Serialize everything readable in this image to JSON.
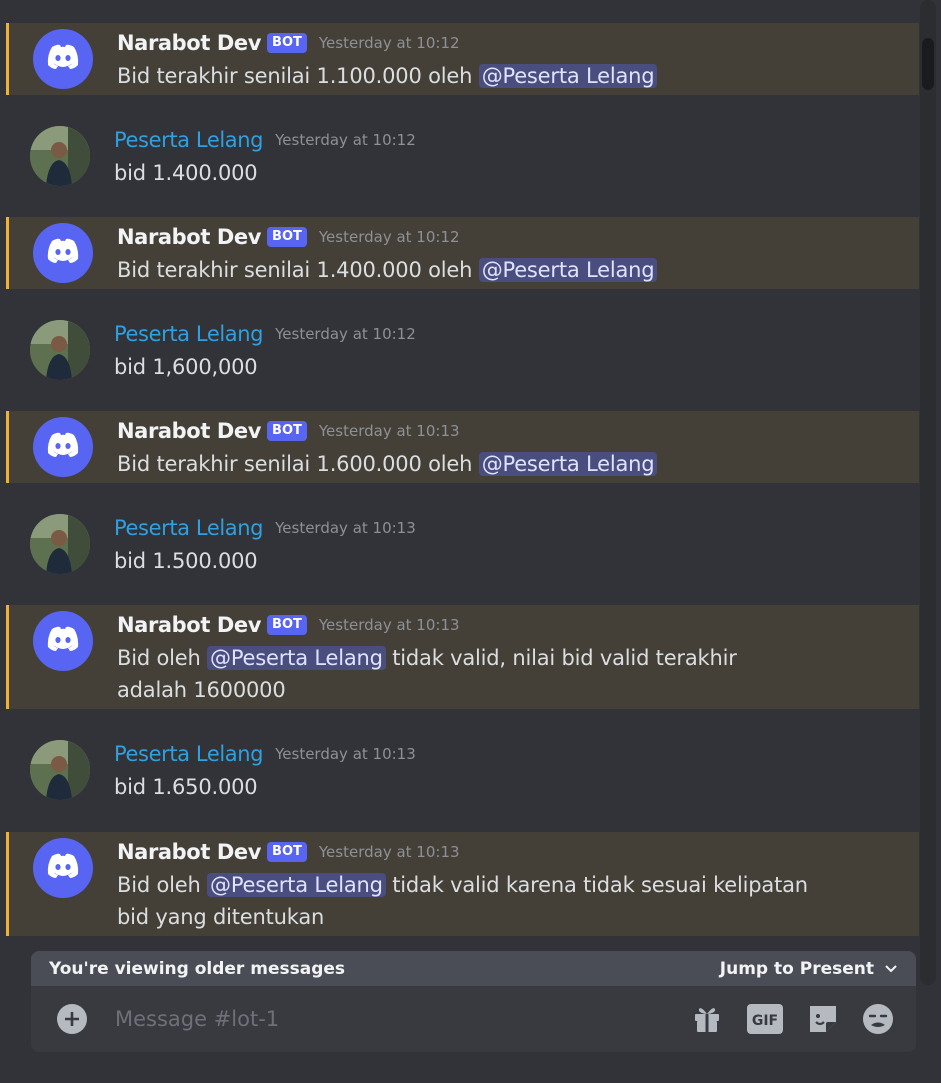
{
  "messages": [
    {
      "author": "Narabot Dev",
      "bot": true,
      "timestamp": "Yesterday at 10:12",
      "pre": "Bid terakhir senilai 1.100.000 oleh ",
      "mention": "@Peserta Lelang",
      "post": ""
    },
    {
      "author": "Peserta Lelang",
      "bot": false,
      "timestamp": "Yesterday at 10:12",
      "pre": "bid 1.400.000",
      "mention": "",
      "post": ""
    },
    {
      "author": "Narabot Dev",
      "bot": true,
      "timestamp": "Yesterday at 10:12",
      "pre": "Bid terakhir senilai 1.400.000 oleh ",
      "mention": "@Peserta Lelang",
      "post": ""
    },
    {
      "author": "Peserta Lelang",
      "bot": false,
      "timestamp": "Yesterday at 10:12",
      "pre": "bid 1,600,000",
      "mention": "",
      "post": ""
    },
    {
      "author": "Narabot Dev",
      "bot": true,
      "timestamp": "Yesterday at 10:13",
      "pre": "Bid terakhir senilai 1.600.000 oleh ",
      "mention": "@Peserta Lelang",
      "post": ""
    },
    {
      "author": "Peserta Lelang",
      "bot": false,
      "timestamp": "Yesterday at 10:13",
      "pre": "bid 1.500.000",
      "mention": "",
      "post": ""
    },
    {
      "author": "Narabot Dev",
      "bot": true,
      "timestamp": "Yesterday at 10:13",
      "pre": "Bid oleh ",
      "mention": "@Peserta Lelang",
      "post": " tidak valid, nilai bid valid terakhir adalah 1600000"
    },
    {
      "author": "Peserta Lelang",
      "bot": false,
      "timestamp": "Yesterday at 10:13",
      "pre": "bid 1.650.000",
      "mention": "",
      "post": ""
    },
    {
      "author": "Narabot Dev",
      "bot": true,
      "timestamp": "Yesterday at 10:13",
      "pre": "Bid oleh ",
      "mention": "@Peserta Lelang",
      "post": " tidak valid karena tidak sesuai kelipatan bid yang ditentukan"
    }
  ],
  "bot_tag": "BOT",
  "older_bar": {
    "text": "You're viewing older messages",
    "jump_label": "Jump to Present"
  },
  "composer": {
    "placeholder": "Message #lot-1"
  },
  "colors": {
    "background": "#313338",
    "highlight_bg": "#444038",
    "highlight_border": "#f0b232",
    "blurple": "#5865f2",
    "user_name": "#2fa0e0",
    "mention_bg": "#4a4e7e"
  },
  "icons": [
    "discord-logo-icon",
    "plus-icon",
    "gift-icon",
    "gif-icon",
    "sticker-icon",
    "emoji-icon",
    "chevron-down-icon"
  ]
}
